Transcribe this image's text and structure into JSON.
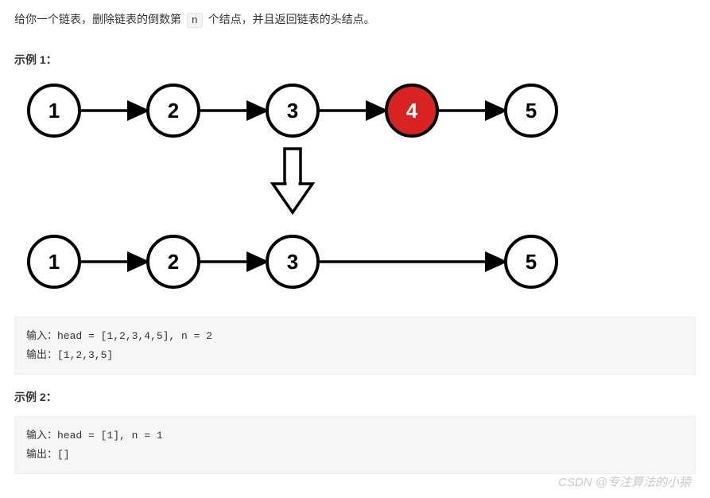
{
  "description": {
    "pre": "给你一个链表，删除链表的倒数第 ",
    "var": "n",
    "post": " 个结点，并且返回链表的头结点。"
  },
  "example1_title": "示例 1：",
  "example1_code": "输入：head = [1,2,3,4,5], n = 2\n输出：[1,2,3,5]",
  "example2_title": "示例 2：",
  "example2_code": "输入：head = [1], n = 1\n输出：[]",
  "watermark": "CSDN @专注算法的小猿",
  "chart_data": {
    "type": "diagram",
    "shape": "linked-list-remove-nth-from-end",
    "before": [
      1,
      2,
      3,
      4,
      5
    ],
    "highlighted_index": 3,
    "highlighted_value": 4,
    "highlight_color": "#d92222",
    "after": [
      1,
      2,
      3,
      5
    ],
    "node_radius": 32,
    "node_stroke": "#000000",
    "node_fill_default": "#ffffff",
    "arrow_between_rows": true
  }
}
